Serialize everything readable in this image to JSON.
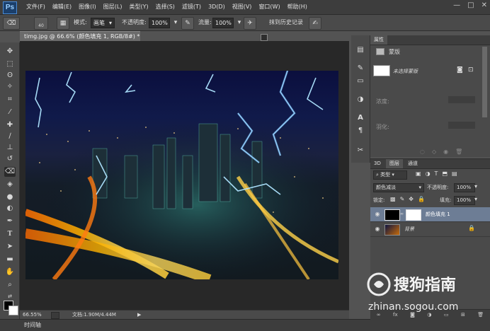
{
  "app": {
    "logo": "Ps"
  },
  "menus": [
    "文件(F)",
    "编辑(E)",
    "图像(I)",
    "图层(L)",
    "类型(Y)",
    "选择(S)",
    "滤镜(T)",
    "3D(D)",
    "视图(V)",
    "窗口(W)",
    "帮助(H)"
  ],
  "window_controls": {
    "minimize": "—",
    "maximize": "□",
    "close": "✕"
  },
  "options": {
    "brush_size": "40",
    "mode_label": "模式:",
    "mode_value": "画笔",
    "opacity_label": "不透明度:",
    "opacity_value": "100%",
    "flow_label": "流量:",
    "flow_value": "100%",
    "history_label": "抹到历史记录"
  },
  "document": {
    "tab_title": "timg.jpg @ 66.6% (颜色填充 1, RGB/8#) *",
    "close": "×"
  },
  "status": {
    "zoom": "66.55%",
    "doc_info": "文档:1.90M/4.44M"
  },
  "timeline": {
    "label": "时间轴"
  },
  "properties": {
    "tab": "属性",
    "section": "蒙版",
    "mask_label": "未选择蒙版",
    "density_label": "浓度:",
    "feather_label": "羽化:"
  },
  "layers": {
    "tabs": [
      "3D",
      "图层",
      "通道"
    ],
    "filter_type": "类型",
    "blend_mode": "颜色减淡",
    "opacity_label": "不透明度:",
    "opacity_value": "100%",
    "lock_label": "锁定:",
    "fill_label": "填充:",
    "fill_value": "100%",
    "items": [
      {
        "name": "颜色填充 1",
        "selected": true
      },
      {
        "name": "背景",
        "selected": false
      }
    ],
    "footer_icons": [
      "link-icon",
      "fx-icon",
      "mask-icon",
      "adjustment-icon",
      "folder-icon",
      "new-layer-icon",
      "trash-icon"
    ]
  },
  "watermark": {
    "brand": "搜狗指南",
    "url": "zhinan.sogou.com"
  },
  "colors": {
    "menubar": "#3d3d3d",
    "panel": "#4a4a4a",
    "workspace": "#535353",
    "selected_layer": "#6d7d95",
    "accent": "#4a8ad4"
  }
}
